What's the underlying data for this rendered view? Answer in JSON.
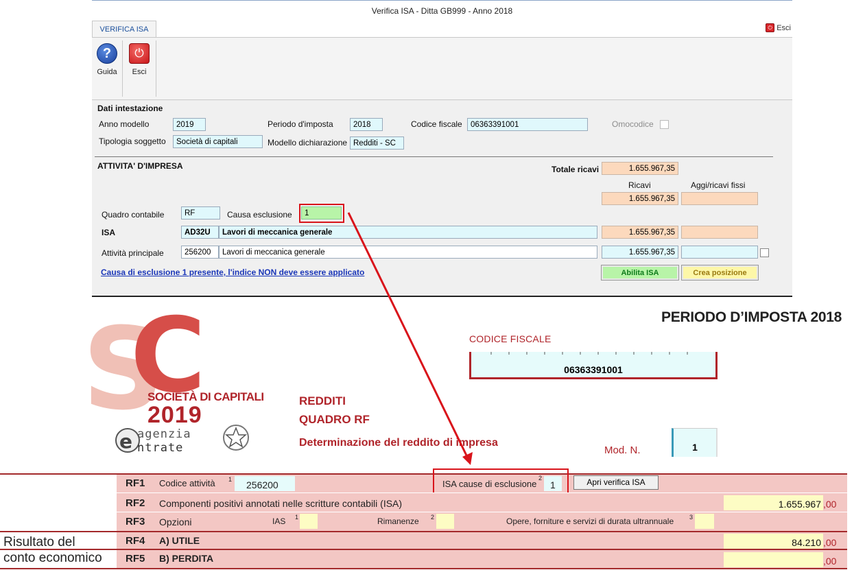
{
  "window": {
    "title": "Verifica ISA - Ditta GB999 - Anno 2018",
    "tab": "VERIFICA ISA",
    "exit_top": "Esci",
    "ribbon": {
      "guida": "Guida",
      "esci": "Esci"
    }
  },
  "dati": {
    "section_title": "Dati intestazione",
    "anno_modello_label": "Anno modello",
    "anno_modello": "2019",
    "periodo_label": "Periodo d'imposta",
    "periodo": "2018",
    "cf_label": "Codice fiscale",
    "cf": "06363391001",
    "omocodice_label": "Omocodice",
    "tipologia_label": "Tipologia soggetto",
    "tipologia": "Società di capitali",
    "modello_label": "Modello dichiarazione",
    "modello": "Redditi - SC"
  },
  "attivita": {
    "section_title": "ATTIVITA' D'IMPRESA",
    "totale_ricavi_label": "Totale ricavi",
    "totale_ricavi": "1.655.967,35",
    "col_ricavi": "Ricavi",
    "col_aggi": "Aggi/ricavi fissi",
    "ricavi_row": "1.655.967,35",
    "quadro_label": "Quadro contabile",
    "quadro": "RF",
    "causa_label": "Causa esclusione",
    "causa": "1",
    "isa_label": "ISA",
    "isa_code": "AD32U",
    "isa_desc": "Lavori di meccanica generale",
    "isa_ricavi": "1.655.967,35",
    "principale_label": "Attività principale",
    "principale_code": "256200",
    "principale_desc": "Lavori di meccanica generale",
    "principale_ricavi": "1.655.967,35",
    "warning_link": "Causa di esclusione 1 presente, l'indice NON deve essere applicato",
    "btn_abilita": "Abilita ISA",
    "btn_crea": "Crea posizione"
  },
  "form": {
    "periodo": "PERIODO D’IMPOSTA 2018",
    "cf_label": "CODICE FISCALE",
    "cf": "06363391001",
    "logo_letters": "SC",
    "societa": "SOCIETÀ DI CAPITALI",
    "year": "2019",
    "agenzia": "agenzia",
    "entrate": "ntrate",
    "redditi": "REDDITI",
    "quadro": "QUADRO RF",
    "determinazione": "Determinazione del reddito di impresa",
    "mod_label": "Mod. N.",
    "mod_value": "1"
  },
  "rf": {
    "rf1": {
      "code": "RF1",
      "label": "Codice attività",
      "sup": "1",
      "value": "256200",
      "isa_label": "ISA cause di esclusione",
      "isa_sup": "2",
      "isa_value": "1",
      "button": "Apri verifica ISA"
    },
    "rf2": {
      "code": "RF2",
      "label": "Componenti positivi annotati nelle scritture contabili (ISA)",
      "value": "1.655.967",
      "dec": ",00"
    },
    "rf3": {
      "code": "RF3",
      "label": "Opzioni",
      "ias": "IAS",
      "ias_sup": "1",
      "rim": "Rimanenze",
      "rim_sup": "2",
      "opere": "Opere, forniture e servizi di durata ultrannuale",
      "opere_sup": "3"
    },
    "rf4": {
      "code": "RF4",
      "label": "A) UTILE",
      "value": "84.210",
      "dec": ",00"
    },
    "rf5": {
      "code": "RF5",
      "label": "B) PERDITA",
      "value": "",
      "dec": ",00"
    },
    "risultato": [
      "Risultato del",
      "conto economico"
    ]
  },
  "colors": {
    "form_red": "#b0242a",
    "row_pink": "#f3c7c4",
    "highlight_red": "#d9141b",
    "cyan_field": "#e0f8fc",
    "peach_field": "#fcd9bd"
  }
}
